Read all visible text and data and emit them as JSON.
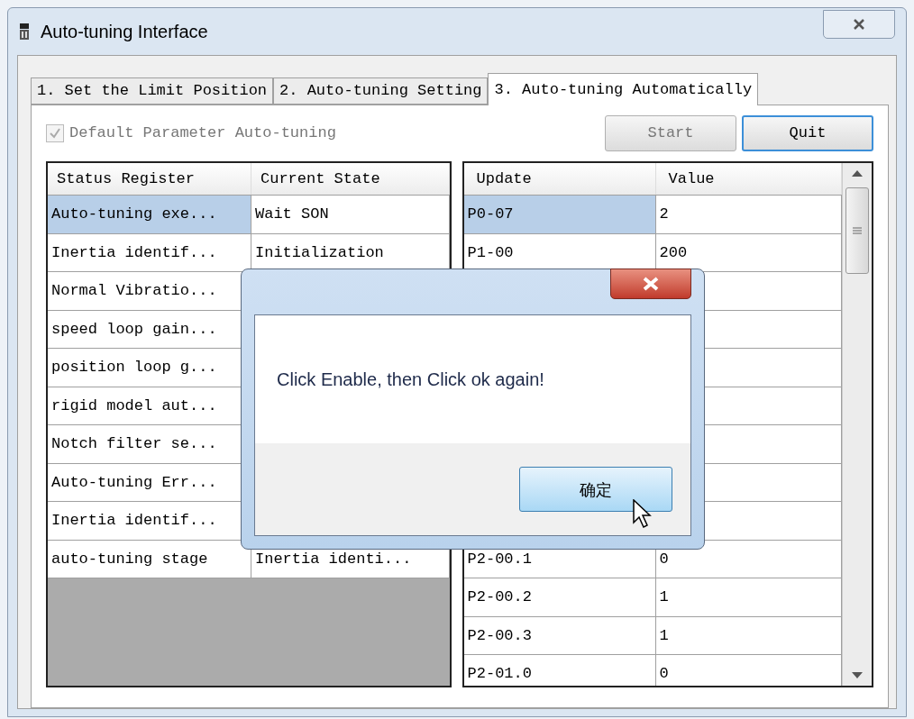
{
  "window": {
    "title": "Auto-tuning Interface"
  },
  "tabs": [
    {
      "label": "1. Set the Limit Position",
      "selected": false
    },
    {
      "label": "2. Auto-tuning Setting",
      "selected": false
    },
    {
      "label": "3. Auto-tuning Automatically",
      "selected": true
    }
  ],
  "default_checkbox": {
    "label": "Default Parameter Auto-tuning",
    "checked": true,
    "disabled": true
  },
  "buttons": [
    {
      "label": "Start",
      "disabled": true,
      "focused": false
    },
    {
      "label": "Quit",
      "disabled": false,
      "focused": true
    }
  ],
  "status_table": {
    "columns": [
      "Status Register",
      "Current State"
    ],
    "rows": [
      {
        "register": "Auto-tuning exe...",
        "state": "Wait SON",
        "selected": true
      },
      {
        "register": "Inertia identif...",
        "state": "Initialization",
        "selected": false
      },
      {
        "register": "Normal Vibratio...",
        "selected": false
      },
      {
        "register": "speed loop gain...",
        "selected": false
      },
      {
        "register": "position loop g...",
        "selected": false
      },
      {
        "register": "rigid model aut...",
        "selected": false
      },
      {
        "register": "Notch filter se...",
        "selected": false
      },
      {
        "register": "Auto-tuning Err...",
        "selected": false
      },
      {
        "register": "Inertia identif...",
        "selected": false
      },
      {
        "register": "auto-tuning stage",
        "state": "Inertia identi...",
        "selected": false
      }
    ]
  },
  "update_table": {
    "columns": [
      "Update",
      "Value"
    ],
    "rows": [
      {
        "kind": "entry",
        "update": "P0-07",
        "value": "2",
        "selected": true
      },
      {
        "kind": "entry",
        "update": "P1-00",
        "value": "200",
        "selected": false
      },
      {
        "kind": "covered"
      },
      {
        "kind": "covered"
      },
      {
        "kind": "covered"
      },
      {
        "kind": "covered"
      },
      {
        "kind": "covered"
      },
      {
        "kind": "covered"
      },
      {
        "kind": "covered"
      },
      {
        "kind": "entry",
        "update": "P2-00.1",
        "value": "0",
        "selected": false
      },
      {
        "kind": "entry",
        "update": "P2-00.2",
        "value": "1",
        "selected": false
      },
      {
        "kind": "entry",
        "update": "P2-00.3",
        "value": "1",
        "selected": false
      },
      {
        "kind": "entry",
        "update": "P2-01.0",
        "value": "0",
        "selected": false
      }
    ]
  },
  "dialog": {
    "message": "Click Enable, then Click ok again!",
    "button": "确定"
  }
}
